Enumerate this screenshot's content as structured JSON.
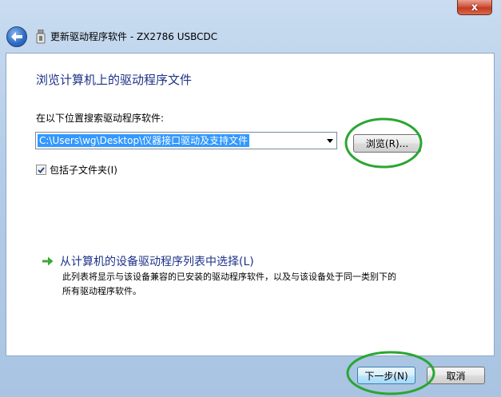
{
  "window": {
    "title": "更新驱动程序软件 - ZX2786 USBCDC",
    "close_glyph": "x"
  },
  "main": {
    "heading": "浏览计算机上的驱动程序文件",
    "search_label": "在以下位置搜索驱动程序软件:",
    "path_value": "C:\\Users\\wg\\Desktop\\仪器接口驱动及支持文件",
    "browse_label": "浏览(R)...",
    "include_subfolders_label": "包括子文件夹(I)",
    "include_subfolders_checked": true,
    "pick_title": "从计算机的设备驱动程序列表中选择(L)",
    "pick_desc_line1": "此列表将显示与该设备兼容的已安装的驱动程序软件，以及与该设备处于同一类别下的",
    "pick_desc_line2": "所有驱动程序软件。"
  },
  "footer": {
    "next_label": "下一步(N)",
    "cancel_label": "取消"
  },
  "colors": {
    "link_blue": "#1e3287",
    "annotation_green": "#2aa632",
    "selection_blue": "#3399ff",
    "arrow_green": "#3aa83a"
  },
  "icons": [
    "back-arrow-icon",
    "device-icon",
    "dropdown-arrow-icon",
    "green-arrow-icon",
    "checkmark-icon"
  ]
}
